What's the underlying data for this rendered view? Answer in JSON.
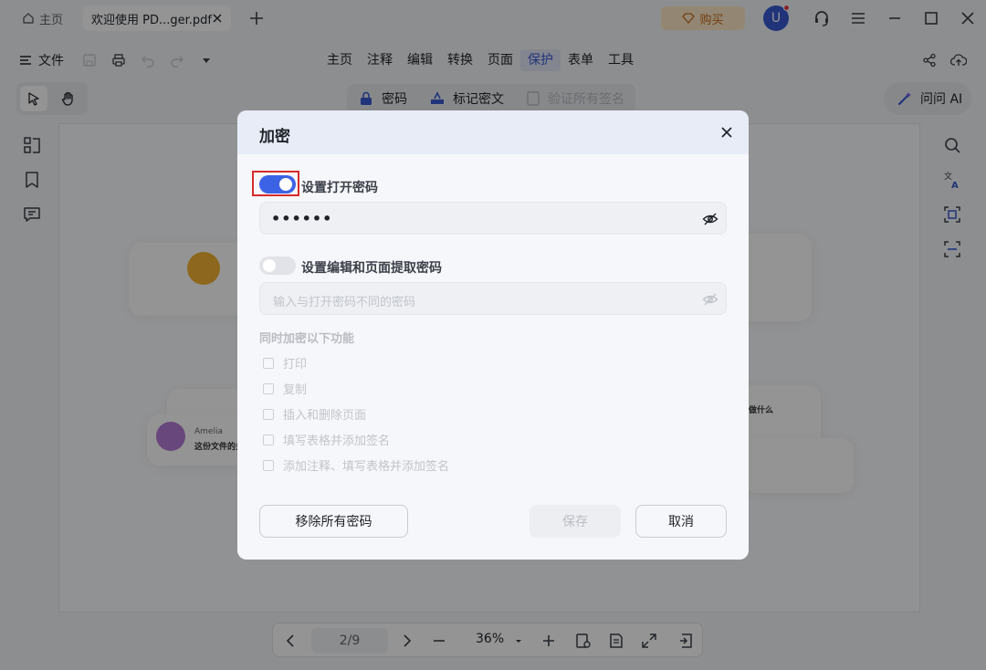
{
  "titlebar": {
    "home_tab": "主页",
    "doc_tab": "欢迎使用 PD...ger.pdf",
    "buy_label": "购买",
    "avatar_letter": "U"
  },
  "menubar": {
    "file_label": "文件",
    "items": [
      {
        "label": "主页"
      },
      {
        "label": "注释"
      },
      {
        "label": "编辑"
      },
      {
        "label": "转换"
      },
      {
        "label": "页面"
      },
      {
        "label": "保护",
        "active": true
      },
      {
        "label": "表单"
      },
      {
        "label": "工具"
      }
    ]
  },
  "subtoolbar": {
    "password": "密码",
    "redact": "标记密文",
    "verify": "验证所有签名"
  },
  "ask_ai": "问问 AI",
  "document": {
    "card_name": "Amelia",
    "card_text": "这份文件的关",
    "card_right_text": "能做什么"
  },
  "bottom_bar": {
    "page": "2/9",
    "zoom": "36%"
  },
  "dialog": {
    "title": "加密",
    "open_password_toggle_label": "设置打开密码",
    "open_password_on": true,
    "open_password_value": "••••••",
    "edit_password_toggle_label": "设置编辑和页面提取密码",
    "edit_password_on": false,
    "edit_password_placeholder": "输入与打开密码不同的密码",
    "section_label": "同时加密以下功能",
    "options": [
      {
        "label": "打印"
      },
      {
        "label": "复制"
      },
      {
        "label": "插入和删除页面"
      },
      {
        "label": "填写表格并添加签名"
      },
      {
        "label": "添加注释、填写表格并添加签名"
      }
    ],
    "remove_all_label": "移除所有密码",
    "save_label": "保存",
    "cancel_label": "取消"
  },
  "colors": {
    "accent": "#3c63e6",
    "focus_ring": "#d62b2b",
    "buy_bg": "#fde9c9",
    "avatar": "#3a5bd3"
  }
}
